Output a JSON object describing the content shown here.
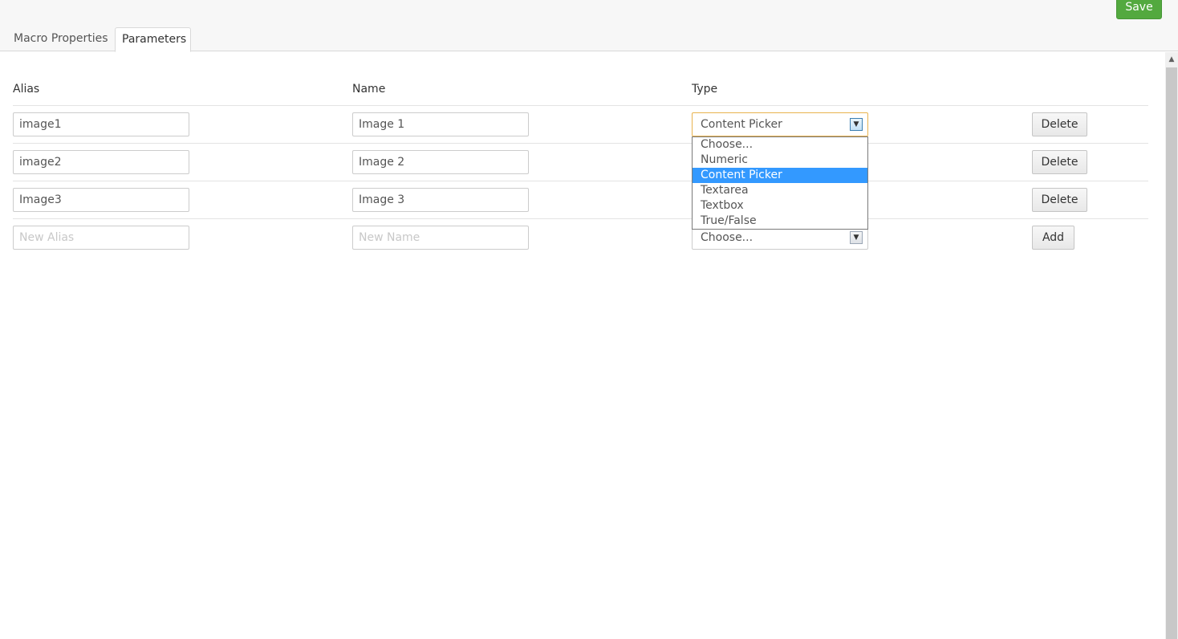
{
  "header": {
    "save_label": "Save",
    "tabs": [
      {
        "label": "Macro Properties"
      },
      {
        "label": "Parameters"
      }
    ]
  },
  "columns": {
    "alias": "Alias",
    "name": "Name",
    "type": "Type"
  },
  "rows": [
    {
      "alias": "image1",
      "name": "Image 1",
      "type": "Content Picker",
      "action": "Delete"
    },
    {
      "alias": "image2",
      "name": "Image 2",
      "type": "",
      "action": "Delete"
    },
    {
      "alias": "Image3",
      "name": "Image 3",
      "type": "",
      "action": "Delete"
    }
  ],
  "new_row": {
    "alias_placeholder": "New Alias",
    "name_placeholder": "New Name",
    "type": "Choose...",
    "action": "Add"
  },
  "type_options": [
    "Choose...",
    "Numeric",
    "Content Picker",
    "Textarea",
    "Textbox",
    "True/False"
  ],
  "selected_option_index": 2,
  "icons": {
    "select_arrow": "chevron-down-icon",
    "scroll_up": "chevron-up-icon"
  },
  "colors": {
    "save_green": "#53a93f",
    "highlight_blue": "#3399ff",
    "focus_orange": "#e8b34e"
  }
}
